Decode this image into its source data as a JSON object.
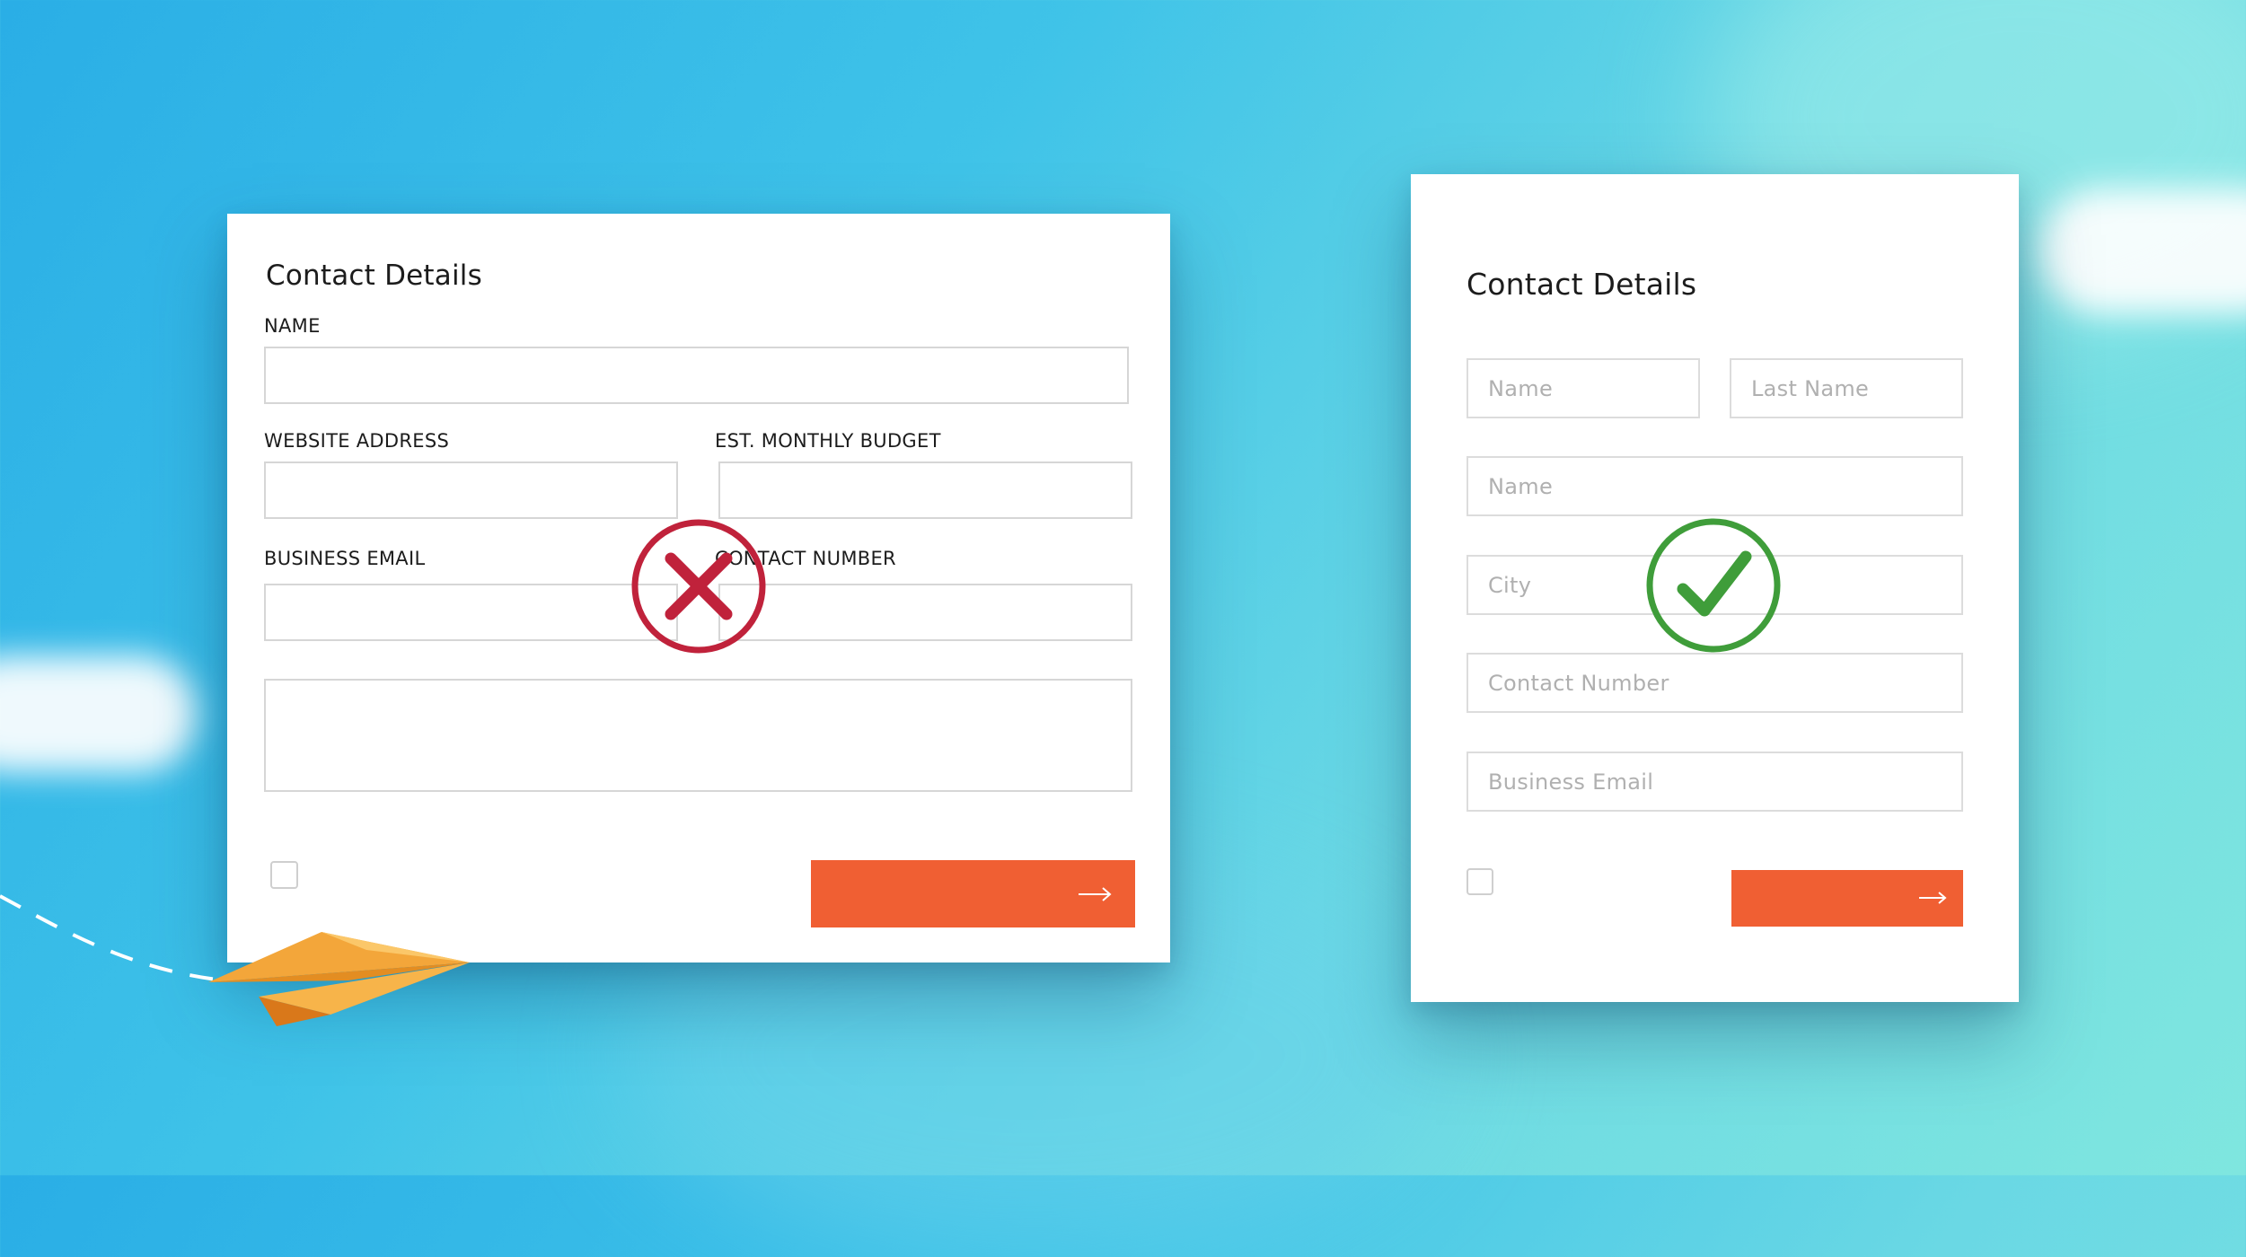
{
  "colors": {
    "accent": "#f05f33",
    "bad": "#c0223b",
    "good": "#3f9d3a",
    "field_border": "#d6d6d6",
    "placeholder": "#b0b0b0"
  },
  "bad_form": {
    "title": "Contact Details",
    "labels": {
      "name": "NAME",
      "website": "WEBSITE ADDRESS",
      "budget": "EST. MONTHLY BUDGET",
      "email": "BUSINESS EMAIL",
      "contact": "CONTACT NUMBER"
    },
    "marker_icon": "x-circle-icon",
    "submit_icon": "arrow-right-icon"
  },
  "good_form": {
    "title": "Contact Details",
    "placeholders": {
      "first_name": "Name",
      "last_name": "Last Name",
      "name": "Name",
      "city": "City",
      "contact": "Contact Number",
      "email": "Business Email"
    },
    "marker_icon": "check-circle-icon",
    "submit_icon": "arrow-right-icon"
  },
  "decor": {
    "plane_icon": "paper-plane-icon",
    "cloud_icon": "cloud-icon"
  }
}
